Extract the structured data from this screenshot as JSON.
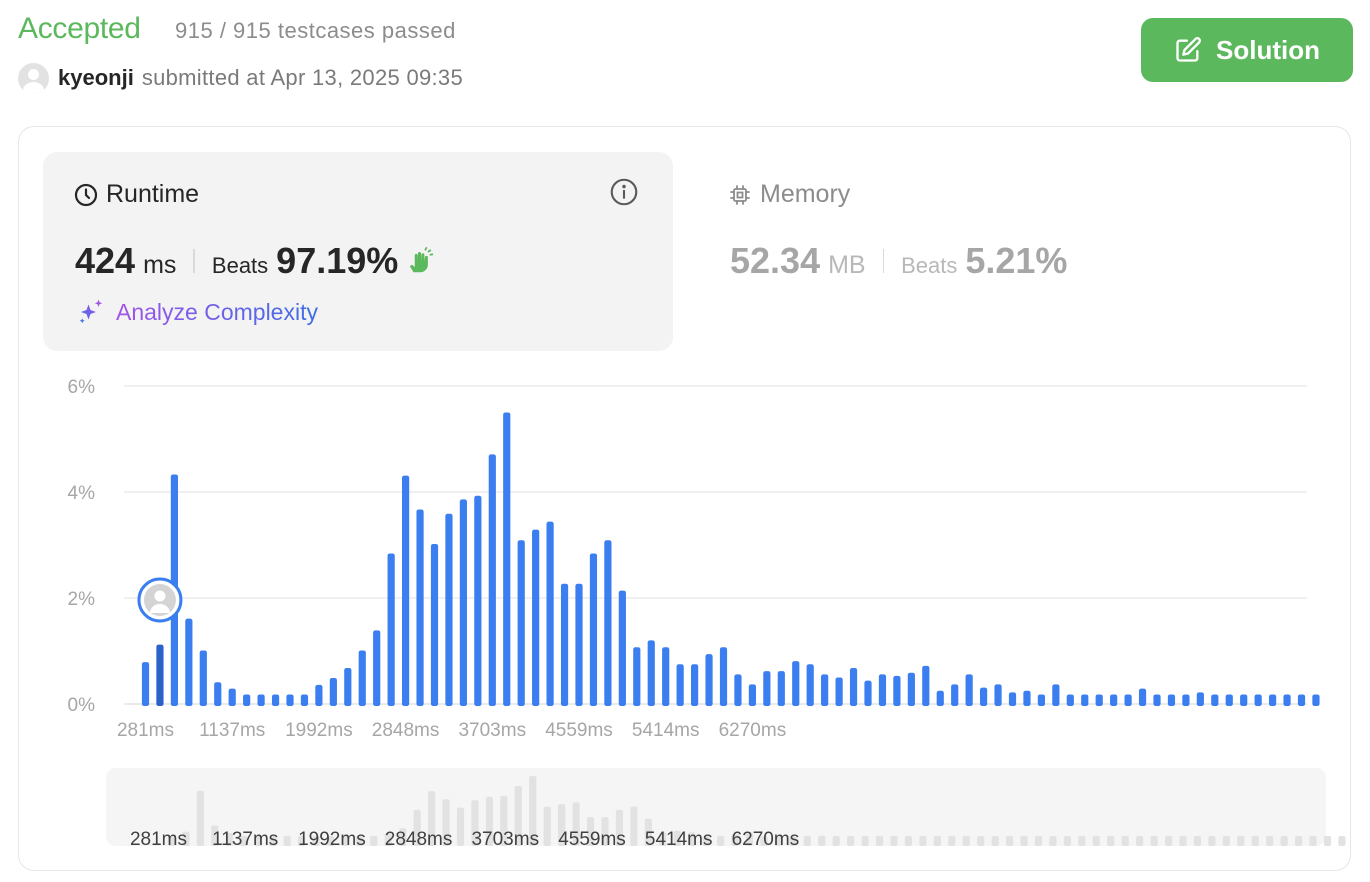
{
  "header": {
    "status": "Accepted",
    "testcases": "915 / 915 testcases passed",
    "username": "kyeonji",
    "submitted_text": "submitted at Apr 13, 2025 09:35",
    "solution_label": "Solution",
    "accent": "#5cb85c"
  },
  "runtime": {
    "title": "Runtime",
    "value": "424",
    "unit": "ms",
    "beats_label": "Beats",
    "beats": "97.19%",
    "analyze_label": "Analyze Complexity"
  },
  "memory": {
    "title": "Memory",
    "value": "52.34",
    "unit": "MB",
    "beats_label": "Beats",
    "beats": "5.21%"
  },
  "chart_data": {
    "type": "bar",
    "ylim": [
      0,
      6
    ],
    "yticks": [
      "6%",
      "4%",
      "2%",
      "0%"
    ],
    "ytick_values": [
      6,
      4,
      2,
      0
    ],
    "xticks": [
      "281ms",
      "1137ms",
      "1992ms",
      "2848ms",
      "3703ms",
      "4559ms",
      "5414ms",
      "6270ms"
    ],
    "grid": true,
    "bar_color": "#3b7ef0",
    "highlight_color": "#2b62c9",
    "highlight_index": 1,
    "values": [
      0.79,
      1.12,
      4.33,
      1.61,
      1.01,
      0.41,
      0.29,
      0.18,
      0.18,
      0.18,
      0.18,
      0.18,
      0.36,
      0.49,
      0.68,
      1.01,
      1.39,
      2.84,
      4.31,
      3.67,
      3.02,
      3.59,
      3.86,
      3.93,
      4.71,
      5.5,
      3.09,
      3.29,
      3.44,
      2.27,
      2.27,
      2.84,
      3.09,
      2.14,
      1.07,
      1.2,
      1.07,
      0.75,
      0.75,
      0.94,
      1.07,
      0.56,
      0.37,
      0.62,
      0.62,
      0.81,
      0.75,
      0.56,
      0.5,
      0.68,
      0.44,
      0.56,
      0.53,
      0.59,
      0.72,
      0.25,
      0.37,
      0.56,
      0.31,
      0.37,
      0.22,
      0.25,
      0.18,
      0.37,
      0.18,
      0.18,
      0.18,
      0.18,
      0.18,
      0.29,
      0.18,
      0.18,
      0.18,
      0.22,
      0.18,
      0.18,
      0.18,
      0.18,
      0.18,
      0.18,
      0.18,
      0.18
    ]
  }
}
